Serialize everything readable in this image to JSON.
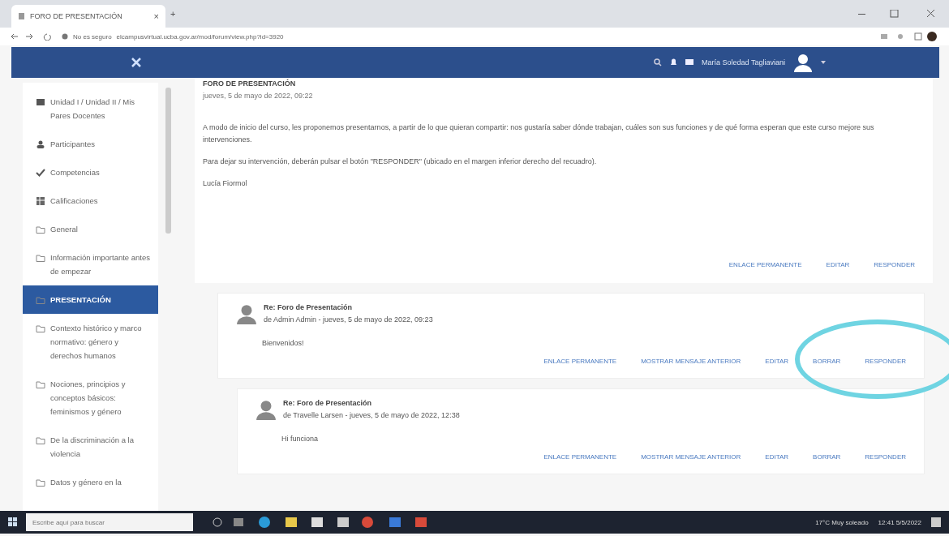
{
  "browser": {
    "tab_title": "FORO DE PRESENTACIÓN",
    "tab_close": "×",
    "new_tab": "+",
    "security": "No es seguro",
    "url": "elcampusvirtual.ucba.gov.ar/mod/forum/view.php?id=3920"
  },
  "navbar": {
    "user_name": "María Soledad Tagliaviani"
  },
  "sidebar": {
    "items": [
      {
        "label": "Unidad I / Unidad II / Mis Pares Docentes",
        "kind": "grid",
        "selected": false
      },
      {
        "label": "Participantes",
        "kind": "people",
        "selected": false
      },
      {
        "label": "Competencias",
        "kind": "check",
        "selected": false
      },
      {
        "label": "Calificaciones",
        "kind": "table",
        "selected": false
      },
      {
        "label": "General",
        "kind": "folder",
        "selected": false
      },
      {
        "label": "Información importante antes de empezar",
        "kind": "folder",
        "selected": false
      },
      {
        "label": "PRESENTACIÓN",
        "kind": "folder",
        "selected": true
      },
      {
        "label": "Contexto histórico y marco normativo: género y derechos humanos",
        "kind": "folder",
        "selected": false
      },
      {
        "label": "Nociones, principios y conceptos básicos: feminismos y género",
        "kind": "folder",
        "selected": false
      },
      {
        "label": "De la discriminación a la violencia",
        "kind": "folder",
        "selected": false
      },
      {
        "label": "Datos y género en la",
        "kind": "folder",
        "selected": false
      }
    ]
  },
  "post": {
    "title": "FORO DE PRESENTACIÓN",
    "date": "jueves, 5 de mayo de 2022, 09:22",
    "paragraphs": [
      "A modo de inicio del curso, les proponemos presentarnos, a partir de lo que quieran compartir: nos gustaría saber dónde trabajan, cuáles son sus funciones y de qué forma esperan que este curso mejore sus intervenciones.",
      "Para dejar su intervención, deberán pulsar el botón \"RESPONDER\" (ubicado en el margen inferior derecho del recuadro).",
      "Lucía Fiormol"
    ],
    "actions": [
      "ENLACE PERMANENTE",
      "EDITAR",
      "RESPONDER"
    ]
  },
  "replies": [
    {
      "subject": "Re: Foro de Presentación",
      "byline": "de Admin Admin - jueves, 5 de mayo de 2022, 09:23",
      "message": "Bienvenidos!",
      "actions": [
        "ENLACE PERMANENTE",
        "MOSTRAR MENSAJE ANTERIOR",
        "EDITAR",
        "BORRAR",
        "RESPONDER"
      ]
    },
    {
      "subject": "Re: Foro de Presentación",
      "byline": "de Travelle Larsen - jueves, 5 de mayo de 2022, 12:38",
      "message": "Hi funciona",
      "actions": [
        "ENLACE PERMANENTE",
        "MOSTRAR MENSAJE ANTERIOR",
        "EDITAR",
        "BORRAR",
        "RESPONDER"
      ]
    }
  ],
  "taskbar": {
    "search_placeholder": "Escribe aquí para buscar",
    "weather": "17°C Muy soleado",
    "time": "12:41",
    "date": "5/5/2022"
  }
}
